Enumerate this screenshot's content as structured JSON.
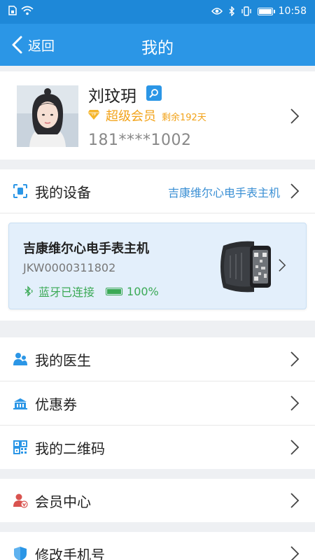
{
  "status_bar": {
    "time": "10:58",
    "battery_level": 1.0
  },
  "nav": {
    "back_label": "返回",
    "title": "我的"
  },
  "profile": {
    "name": "刘玟玥",
    "member_label": "超级会员",
    "member_remaining": "剩余192天",
    "phone": "181****1002"
  },
  "devices": {
    "label": "我的设备",
    "current_device_name": "吉康维尔心电手表主机",
    "card": {
      "title": "吉康维尔心电手表主机",
      "device_id": "JKW0000311802",
      "bluetooth_status": "蓝牙已连接",
      "battery_text": "100%",
      "battery_level": 1.0
    }
  },
  "menu": {
    "doctor": "我的医生",
    "coupons": "优惠券",
    "qrcode": "我的二维码",
    "member_center": "会员中心",
    "change_phone": "修改手机号"
  },
  "colors": {
    "brand_blue": "#2b96e6",
    "member_gold": "#f2a31a",
    "connected_green": "#3aa955"
  }
}
